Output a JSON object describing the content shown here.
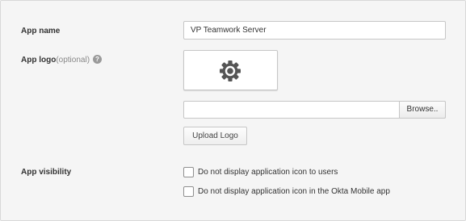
{
  "form": {
    "app_name": {
      "label": "App name",
      "value": "VP Teamwork Server"
    },
    "app_logo": {
      "label": "App logo",
      "optional": "(optional)",
      "help_icon": "question-mark-icon",
      "help_glyph": "?",
      "preview_icon": "gear-icon",
      "browse_label": "Browse..",
      "upload_label": "Upload Logo"
    },
    "app_visibility": {
      "label": "App visibility",
      "options": [
        {
          "label": "Do not display application icon to users",
          "checked": false
        },
        {
          "label": "Do not display application icon in the Okta Mobile app",
          "checked": false
        }
      ]
    }
  }
}
